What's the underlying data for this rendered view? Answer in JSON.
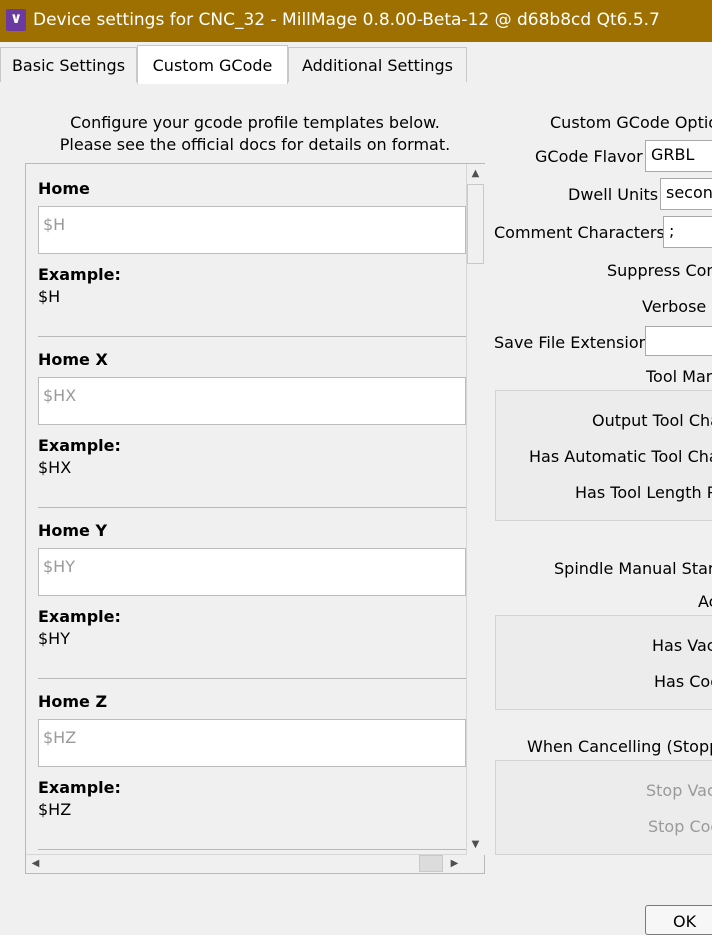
{
  "window": {
    "title": "Device settings for CNC_32 - MillMage 0.8.00-Beta-12 @ d68b8cd Qt6.5.7"
  },
  "tabs": [
    "Basic Settings",
    "Custom GCode",
    "Additional Settings"
  ],
  "intro": {
    "line1": "Configure your gcode profile templates below.",
    "line2": "Please see the official docs for details on format."
  },
  "templates": [
    {
      "label": "Home",
      "placeholder": "$H",
      "example_label": "Example:",
      "example": "$H"
    },
    {
      "label": "Home X",
      "placeholder": "$HX",
      "example_label": "Example:",
      "example": "$HX"
    },
    {
      "label": "Home Y",
      "placeholder": "$HY",
      "example_label": "Example:",
      "example": "$HY"
    },
    {
      "label": "Home Z",
      "placeholder": "$HZ",
      "example_label": "Example:",
      "example": "$HZ"
    }
  ],
  "options": {
    "heading": "Custom GCode Optio",
    "gcode_flavor_label": "GCode Flavor",
    "gcode_flavor_value": "GRBL",
    "dwell_units_label": "Dwell Units",
    "dwell_units_value": "seconc",
    "comment_chars_label": "Comment Characters",
    "comment_chars_value": ";",
    "suppress_label": "Suppress Com",
    "verbose_label": "Verbose G",
    "save_ext_label": "Save File Extension",
    "save_ext_value": "",
    "tool_man_label": "Tool Man",
    "output_tool_label": "Output Tool Cha",
    "has_auto_tool_label": "Has Automatic Tool Cha",
    "has_tool_len_label": "Has Tool Length P",
    "spindle_label": "Spindle Manual Start",
    "ac_label": "Ac",
    "has_vac_label": "Has Vac",
    "has_coo_label": "Has Coo",
    "when_cancel_label": "When Cancelling (Stoppi",
    "stop_vac_label": "Stop Vac",
    "stop_coo_label": "Stop Coo"
  },
  "buttons": {
    "ok": "OK"
  },
  "icons": {
    "app": "millmage-app-icon",
    "scroll_up": "triangle-up-icon",
    "scroll_down": "triangle-down-icon",
    "scroll_left": "triangle-left-icon",
    "scroll_right": "triangle-right-icon"
  },
  "colors": {
    "titlebar": "#9e7001",
    "app_icon": "#6b3aa0"
  }
}
